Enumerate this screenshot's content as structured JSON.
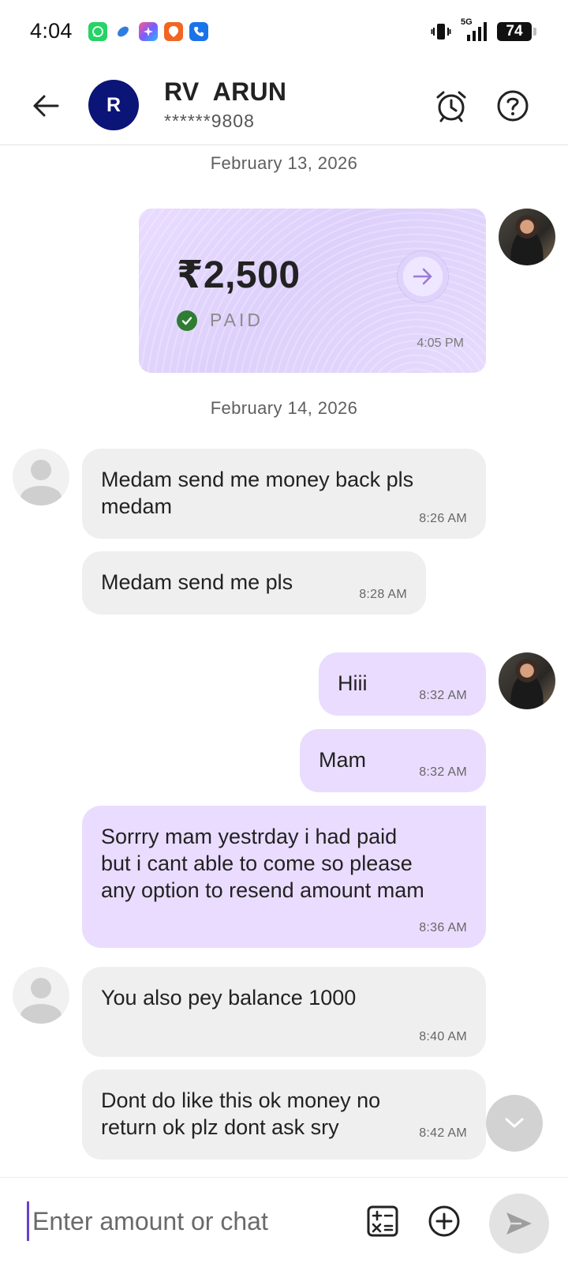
{
  "status_bar": {
    "time": "4:04",
    "battery": "74",
    "network": "5G",
    "app_icons": [
      "whatsapp-icon",
      "blue-app-icon",
      "photos-app-icon",
      "orange-app-icon",
      "phone-app-icon"
    ]
  },
  "header": {
    "avatar_letter": "R",
    "name": "RV  ARUN",
    "phone": "******9808",
    "avatar_color": "#0b1477"
  },
  "chat": {
    "date_1": "February 13, 2026",
    "payment": {
      "amount": "₹2,500",
      "status": "PAID",
      "time": "4:05 PM"
    },
    "date_2": "February 14, 2026",
    "messages": [
      {
        "dir": "in",
        "lines": [
          "Medam send me money back pls",
          "medam"
        ],
        "time": "8:26 AM"
      },
      {
        "dir": "in",
        "lines": [
          "Medam send me pls"
        ],
        "time": "8:28 AM"
      },
      {
        "dir": "out",
        "lines": [
          "Hiii"
        ],
        "time": "8:32 AM"
      },
      {
        "dir": "out",
        "lines": [
          "Mam"
        ],
        "time": "8:32 AM"
      },
      {
        "dir": "out",
        "lines": [
          "Sorrry mam yestrday i had paid",
          "but i cant able to come so please",
          "any option to resend amount mam"
        ],
        "time": "8:36 AM"
      },
      {
        "dir": "in",
        "lines": [
          "You also pey balance 1000"
        ],
        "time": "8:40 AM"
      },
      {
        "dir": "in",
        "lines": [
          "Dont do like this ok money no",
          "return ok plz dont ask sry"
        ],
        "time": "8:42 AM"
      }
    ]
  },
  "composer": {
    "placeholder": "Enter amount or chat",
    "value": ""
  },
  "colors": {
    "incoming_bubble": "#efefef",
    "outgoing_bubble": "#eadcff",
    "paid_check": "#2e7d32",
    "accent": "#6a3fd0"
  }
}
